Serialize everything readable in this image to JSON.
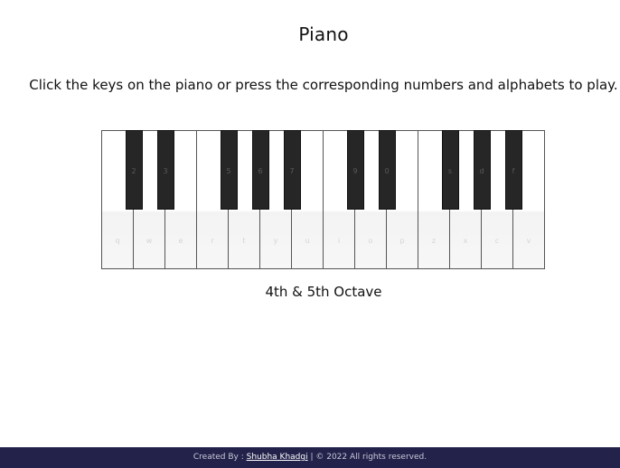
{
  "header": {
    "title": "Piano",
    "instructions": "Click the keys on the piano or press the corresponding numbers and alphabets to play."
  },
  "piano": {
    "white_keys": [
      "q",
      "w",
      "e",
      "r",
      "t",
      "y",
      "u",
      "i",
      "o",
      "p",
      "z",
      "x",
      "c",
      "v"
    ],
    "black_keys": [
      "2",
      "3",
      "5",
      "6",
      "7",
      "9",
      "0",
      "s",
      "d",
      "f"
    ],
    "octave_label": "4th & 5th Octave"
  },
  "footer": {
    "created_by": "Created By :",
    "author": "Shubha Khadgi",
    "copyright": "| © 2022 All rights reserved."
  },
  "colors": {
    "footer_bg": "#23224a",
    "black_key": "#262626"
  }
}
